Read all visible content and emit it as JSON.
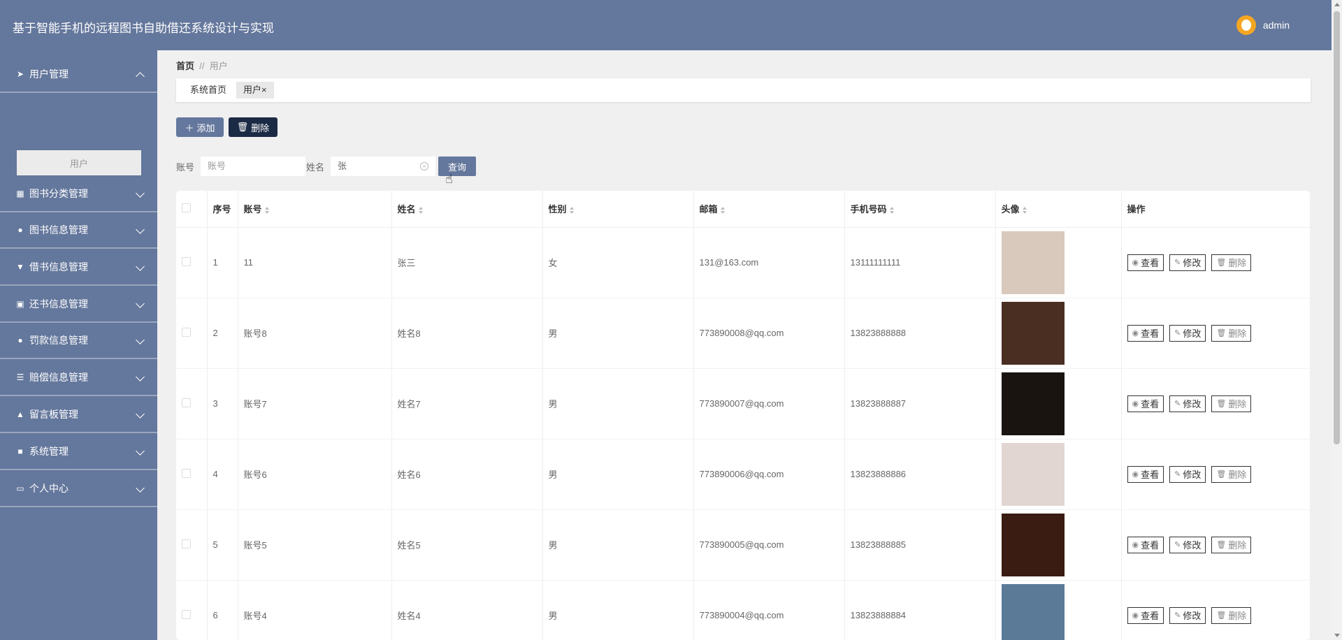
{
  "app": {
    "title": "基于智能手机的远程图书自助借还系统设计与实现",
    "user": "admin"
  },
  "sidebar": {
    "items": [
      {
        "label": "用户管理",
        "icon": "send-icon",
        "expanded": true
      },
      {
        "label": "图书分类管理",
        "icon": "grid-icon"
      },
      {
        "label": "图书信息管理",
        "icon": "location-icon"
      },
      {
        "label": "借书信息管理",
        "icon": "cup-icon"
      },
      {
        "label": "还书信息管理",
        "icon": "clipboard-icon"
      },
      {
        "label": "罚款信息管理",
        "icon": "person-icon"
      },
      {
        "label": "赔偿信息管理",
        "icon": "list-icon"
      },
      {
        "label": "留言板管理",
        "icon": "stamp-icon"
      },
      {
        "label": "系统管理",
        "icon": "lock-icon"
      },
      {
        "label": "个人中心",
        "icon": "card-icon"
      }
    ],
    "submenu": {
      "label": "用户"
    }
  },
  "breadcrumb": {
    "home": "首页",
    "sep": "//",
    "current": "用户"
  },
  "tabs": [
    {
      "label": "系统首页",
      "active": false
    },
    {
      "label": "用户",
      "active": true,
      "close": "×"
    }
  ],
  "actions": {
    "add": "添加",
    "delete": "删除"
  },
  "search": {
    "account_label": "账号",
    "account_placeholder": "账号",
    "name_label": "姓名",
    "name_value": "张",
    "query": "查询"
  },
  "table": {
    "headers": [
      "序号",
      "账号",
      "姓名",
      "性别",
      "邮箱",
      "手机号码",
      "头像",
      "操作"
    ],
    "rows": [
      {
        "no": "1",
        "account": "11",
        "name": "张三",
        "gender": "女",
        "email": "131@163.com",
        "phone": "13111111111",
        "photo": "#d9c8bc"
      },
      {
        "no": "2",
        "account": "账号8",
        "name": "姓名8",
        "gender": "男",
        "email": "773890008@qq.com",
        "phone": "13823888888",
        "photo": "#4a2e22"
      },
      {
        "no": "3",
        "account": "账号7",
        "name": "姓名7",
        "gender": "男",
        "email": "773890007@qq.com",
        "phone": "13823888887",
        "photo": "#1a1410"
      },
      {
        "no": "4",
        "account": "账号6",
        "name": "姓名6",
        "gender": "男",
        "email": "773890006@qq.com",
        "phone": "13823888886",
        "photo": "#e2d6d2"
      },
      {
        "no": "5",
        "account": "账号5",
        "name": "姓名5",
        "gender": "男",
        "email": "773890005@qq.com",
        "phone": "13823888885",
        "photo": "#3a1c12"
      },
      {
        "no": "6",
        "account": "账号4",
        "name": "姓名4",
        "gender": "男",
        "email": "773890004@qq.com",
        "phone": "13823888884",
        "photo": "#5a7a98"
      }
    ],
    "ops": {
      "view": "查看",
      "edit": "修改",
      "delete": "删除"
    }
  },
  "colors": {
    "brand": "#64779c",
    "dark": "#1c2b45"
  }
}
